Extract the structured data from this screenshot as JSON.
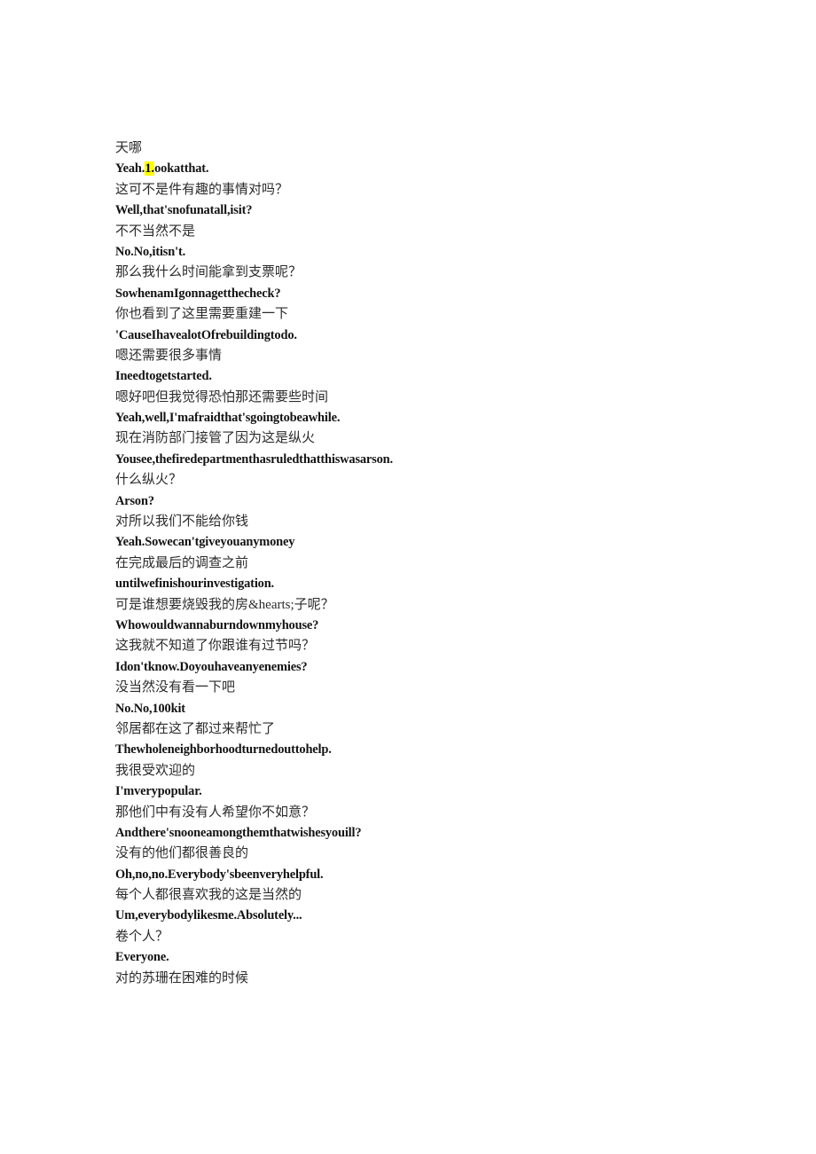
{
  "document": {
    "kind": "bilingual-subtitle-transcript",
    "background_color": "#ffffff",
    "text_color_zh": "#2b2b2b",
    "text_color_en": "#131313",
    "highlight_color": "#ffff00"
  },
  "lines": [
    {
      "id": 1,
      "lang": "zh",
      "text": "天哪"
    },
    {
      "id": 2,
      "lang": "en",
      "text": "Yeah.1.ookatthat.",
      "highlight": {
        "text": "1.",
        "before": "Yeah.",
        "after": "ookatthat."
      }
    },
    {
      "id": 3,
      "lang": "zh",
      "text": "这可不是件有趣的事情对吗？"
    },
    {
      "id": 4,
      "lang": "en",
      "text": "Well,that'snofunatall,isit?"
    },
    {
      "id": 5,
      "lang": "zh",
      "text": "不不当然不是"
    },
    {
      "id": 6,
      "lang": "en",
      "text": "No.No,itisn't."
    },
    {
      "id": 7,
      "lang": "zh",
      "text": "那么我什么时间能拿到支票呢？"
    },
    {
      "id": 8,
      "lang": "en",
      "text": "SowhenamIgonnagetthecheck?"
    },
    {
      "id": 9,
      "lang": "zh",
      "text": "你也看到了这里需要重建一下"
    },
    {
      "id": 10,
      "lang": "en",
      "text": "'CauseIhavealotOfrebuildingtodo."
    },
    {
      "id": 11,
      "lang": "zh",
      "text": "嗯还需要很多事情"
    },
    {
      "id": 12,
      "lang": "en",
      "text": "Ineedtogetstarted."
    },
    {
      "id": 13,
      "lang": "zh",
      "text": "嗯好吧但我觉得恐怕那还需要些时间"
    },
    {
      "id": 14,
      "lang": "en",
      "text": "Yeah,well,I'mafraidthat'sgoingtobeawhile."
    },
    {
      "id": 15,
      "lang": "zh",
      "text": "现在消防部门接管了因为这是纵火"
    },
    {
      "id": 16,
      "lang": "en",
      "text": "Yousee,thefiredepartmenthasruledthatthiswasarson."
    },
    {
      "id": 17,
      "lang": "zh",
      "text": "什么纵火？"
    },
    {
      "id": 18,
      "lang": "en",
      "text": "Arson?"
    },
    {
      "id": 19,
      "lang": "zh",
      "text": "对所以我们不能给你钱"
    },
    {
      "id": 20,
      "lang": "en",
      "text": "Yeah.Sowecan'tgiveyouanymoney"
    },
    {
      "id": 21,
      "lang": "zh",
      "text": "在完成最后的调查之前"
    },
    {
      "id": 22,
      "lang": "en",
      "text": "untilwefinishourinvestigation."
    },
    {
      "id": 23,
      "lang": "zh",
      "text": "可是谁想要烧毁我的房&hearts;子呢？"
    },
    {
      "id": 24,
      "lang": "en",
      "text": "Whowouldwannaburndownmyhouse?"
    },
    {
      "id": 25,
      "lang": "zh",
      "text": "这我就不知道了你跟谁有过节吗？"
    },
    {
      "id": 26,
      "lang": "en",
      "text": "Idon'tknow.Doyouhaveanyenemies?"
    },
    {
      "id": 27,
      "lang": "zh",
      "text": "没当然没有看一下吧"
    },
    {
      "id": 28,
      "lang": "en",
      "text": "No.No,100kit"
    },
    {
      "id": 29,
      "lang": "zh",
      "text": "邻居都在这了都过来帮忙了"
    },
    {
      "id": 30,
      "lang": "en",
      "text": "Thewholeneighborhoodturnedouttohelp."
    },
    {
      "id": 31,
      "lang": "zh",
      "text": "我很受欢迎的"
    },
    {
      "id": 32,
      "lang": "en",
      "text": "I'mverypopular."
    },
    {
      "id": 33,
      "lang": "zh",
      "text": "那他们中有没有人希望你不如意？"
    },
    {
      "id": 34,
      "lang": "en",
      "text": "Andthere'snooneamongthemthatwishesyouill?"
    },
    {
      "id": 35,
      "lang": "zh",
      "text": "没有的他们都很善良的"
    },
    {
      "id": 36,
      "lang": "en",
      "text": "Oh,no,no.Everybody'sbeenveryhelpful."
    },
    {
      "id": 37,
      "lang": "zh",
      "text": "每个人都很喜欢我的这是当然的"
    },
    {
      "id": 38,
      "lang": "en",
      "text": "Um,everybodylikesme.Absolutely..."
    },
    {
      "id": 39,
      "lang": "zh",
      "text": "卷个人？"
    },
    {
      "id": 40,
      "lang": "en",
      "text": "Everyone."
    },
    {
      "id": 41,
      "lang": "zh",
      "text": "对的苏珊在困难的时候"
    }
  ]
}
